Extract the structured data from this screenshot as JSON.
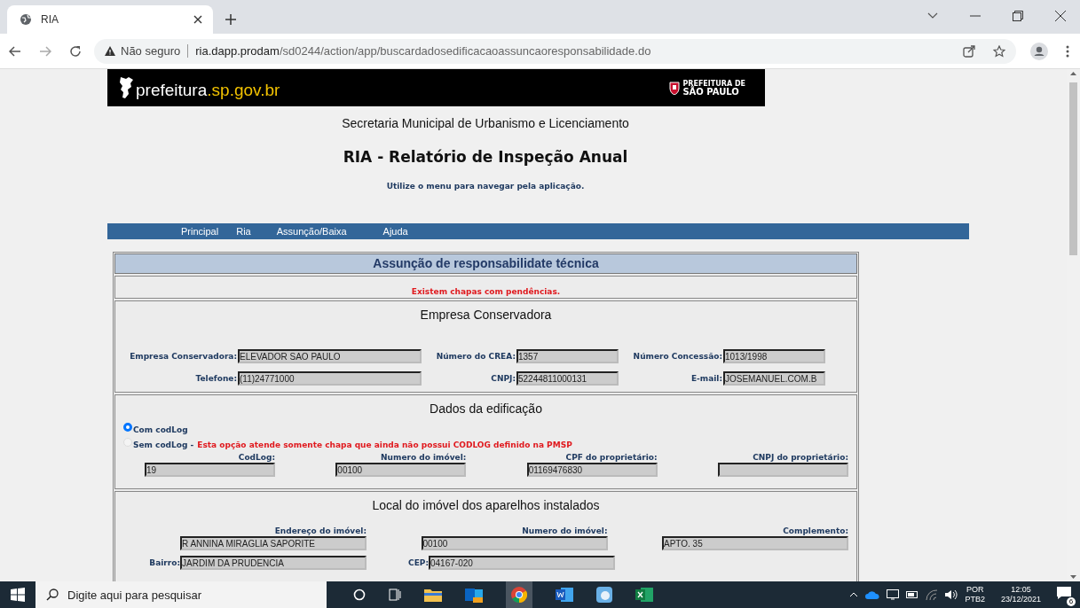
{
  "browser": {
    "tab": {
      "title": "RIA"
    },
    "security": "Não seguro",
    "url_host": "ria.dapp.prodam",
    "url_path": "/sd0244/action/app/buscardadosedificacaoassuncaoresponsabilidade.do"
  },
  "banner": {
    "site_name": "prefeitura",
    "site_domain": ".sp.gov.br",
    "logo_lines": [
      "PREFEITURA DE",
      "SÃO PAULO"
    ]
  },
  "header": {
    "department": "Secretaria Municipal de Urbanismo e Licenciamento",
    "title": "RIA - Relatório de Inspeção Anual",
    "hint": "Utilize o menu para navegar pela aplicação."
  },
  "menu": [
    {
      "label": "Principal"
    },
    {
      "label": "Ria"
    },
    {
      "label": "Assunção/Baixa"
    },
    {
      "label": "Ajuda"
    }
  ],
  "form": {
    "title": "Assunção de responsabilidate técnica",
    "alert": "Existem chapas com pendências.",
    "sections": [
      {
        "kind": "company",
        "title": "Empresa Conservadora",
        "rows": [
          {
            "kind": "inline",
            "fields": [
              {
                "label": "Empresa Conservadora:",
                "value": "ELEVADOR SAO PAULO"
              },
              {
                "label": "Número do CREA:",
                "value": "1357"
              },
              {
                "label": "Número Concessão:",
                "value": "1013/1998"
              }
            ]
          },
          {
            "kind": "inline",
            "fields": [
              {
                "label": "Telefone:",
                "value": "(11)24771000"
              },
              {
                "label": "CNPJ:",
                "value": "52244811000131"
              },
              {
                "label": "E-mail:",
                "value": "JOSEMANUEL.COM.B"
              }
            ]
          }
        ]
      },
      {
        "kind": "building",
        "title": "Dados da edificação",
        "options": [
          {
            "label": "Com codLog",
            "selected": true,
            "disabled": false
          },
          {
            "label": "Sem codLog -",
            "selected": false,
            "disabled": true,
            "note": "Esta opção atende somente chapa que ainda não possui CODLOG definido na PMSP"
          }
        ],
        "rows": [
          {
            "kind": "stacked",
            "fields": [
              {
                "label": "CodLog:",
                "value": "19"
              },
              {
                "label": "Numero do imóvel:",
                "value": "00100"
              },
              {
                "label": "CPF do proprietário:",
                "value": "01169476830"
              },
              {
                "label": "CNPJ do proprietário:"
              }
            ]
          }
        ]
      },
      {
        "kind": "location",
        "title": "Local do imóvel dos aparelhos instalados",
        "rows": [
          {
            "kind": "stacked",
            "fields": [
              {
                "label": "Endereço do imóvel:",
                "value": "R ANNINA MIRAGLIA SAPORITE"
              },
              {
                "label": "Numero do imóvel:",
                "value": "00100"
              },
              {
                "label": "Complemento:",
                "value": "APTO. 35"
              }
            ]
          },
          {
            "kind": "inline",
            "fields": [
              {
                "label": "Bairro:",
                "value": "JARDIM DA PRUDENCIA"
              },
              {
                "label": "CEP:",
                "value": "04167-020"
              }
            ]
          }
        ]
      }
    ]
  },
  "taskbar": {
    "search_placeholder": "Digite aqui para pesquisar",
    "language": "POR",
    "layout": "PTB2",
    "time": "12:05",
    "date": "23/12/2021",
    "notification_count": "6"
  }
}
